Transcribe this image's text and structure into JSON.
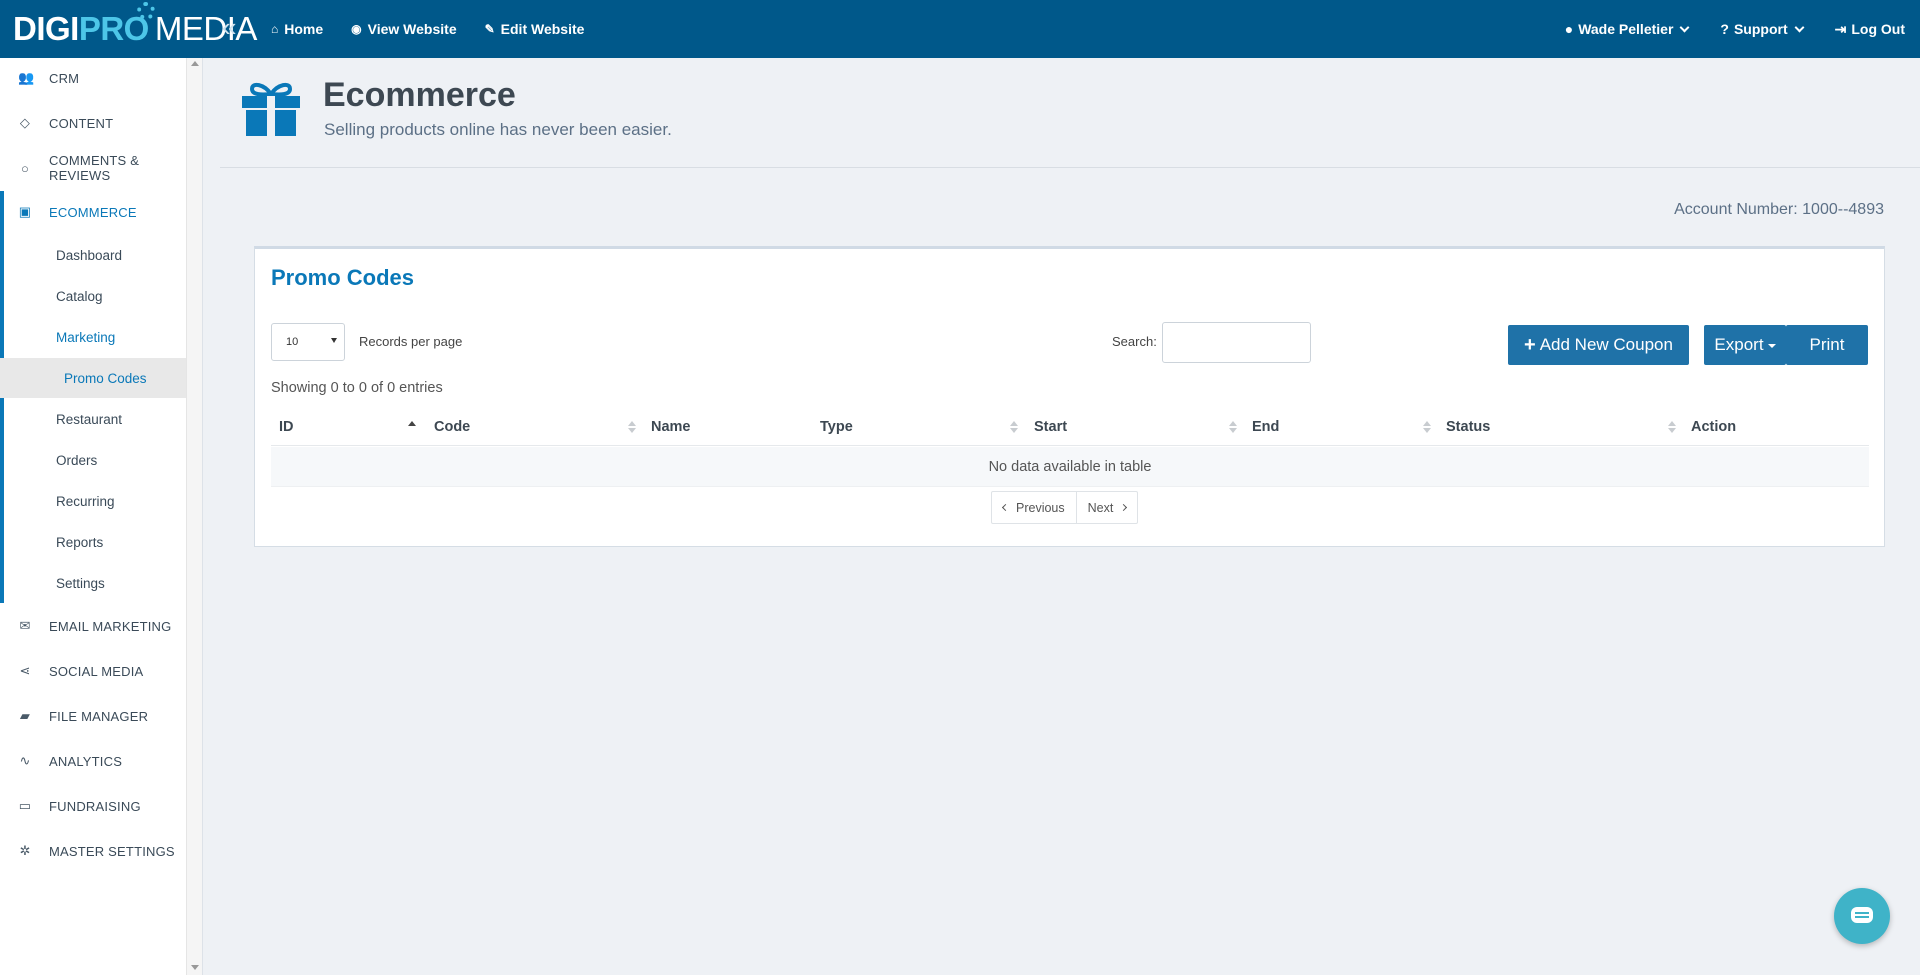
{
  "brand": {
    "part1": "DIGI",
    "part2": "PRO",
    "part3": "MEDIA"
  },
  "topnav": [
    {
      "label": "Home",
      "icon": "home-icon"
    },
    {
      "label": "View Website",
      "icon": "eye-icon"
    },
    {
      "label": "Edit Website",
      "icon": "edit-icon"
    }
  ],
  "topright": {
    "user": "Wade Pelletier",
    "support": "Support",
    "logout": "Log Out"
  },
  "sidebar": {
    "main": [
      {
        "label": "CRM",
        "icon": "users-icon"
      },
      {
        "label": "CONTENT",
        "icon": "diamond-icon"
      },
      {
        "label": "COMMENTS & REVIEWS",
        "icon": "comment-icon"
      },
      {
        "label": "ECOMMERCE",
        "icon": "gift-icon"
      },
      {
        "label": "EMAIL MARKETING",
        "icon": "envelope-icon"
      },
      {
        "label": "SOCIAL MEDIA",
        "icon": "share-icon"
      },
      {
        "label": "FILE MANAGER",
        "icon": "folder-icon"
      },
      {
        "label": "ANALYTICS",
        "icon": "chart-icon"
      },
      {
        "label": "FUNDRAISING",
        "icon": "money-icon"
      },
      {
        "label": "MASTER SETTINGS",
        "icon": "gear-icon"
      }
    ],
    "sub": [
      "Dashboard",
      "Catalog",
      "Marketing",
      "Promo Codes",
      "Restaurant",
      "Orders",
      "Recurring",
      "Reports",
      "Settings"
    ]
  },
  "page": {
    "title": "Ecommerce",
    "subtitle": "Selling products online has never been easier.",
    "account": "Account Number: 1000--4893"
  },
  "panel": {
    "title": "Promo Codes",
    "records_value": "10",
    "records_label": "Records per page",
    "search_label": "Search:",
    "search_value": "",
    "add_button": "Add New Coupon",
    "export_button": "Export",
    "print_button": "Print",
    "showing": "Showing 0 to 0 of 0 entries",
    "columns": [
      "ID",
      "Code",
      "Name",
      "Type",
      "Start",
      "End",
      "Status",
      "Action"
    ],
    "empty": "No data available in table",
    "prev": "Previous",
    "next": "Next"
  },
  "colors": {
    "topbar": "#00588a",
    "accent": "#0a78b8",
    "button": "#1f72a8",
    "chat": "#3fb3c8"
  }
}
